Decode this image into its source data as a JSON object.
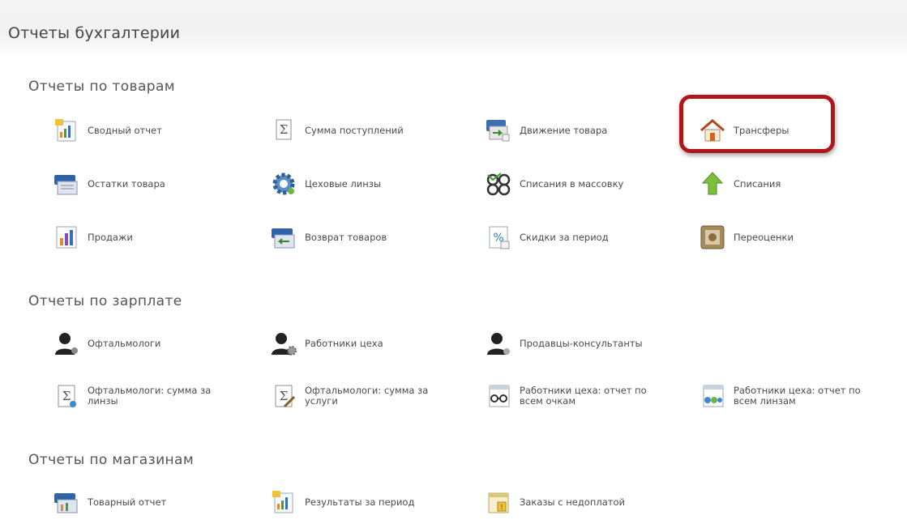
{
  "header": {
    "title": "Отчеты бухгалтерии"
  },
  "sections": [
    {
      "title": "Отчеты по товарам",
      "items": [
        {
          "label": "Сводный отчет",
          "icon": "summary-report-icon"
        },
        {
          "label": "Сумма поступлений",
          "icon": "sigma-document-icon"
        },
        {
          "label": "Движение товара",
          "icon": "goods-movement-icon"
        },
        {
          "label": "Трансферы",
          "icon": "house-icon"
        },
        {
          "label": "Остатки товара",
          "icon": "goods-stock-icon"
        },
        {
          "label": "Цеховые линзы",
          "icon": "gear-icon"
        },
        {
          "label": "Списания в массовку",
          "icon": "glasses-icon"
        },
        {
          "label": "Списания",
          "icon": "up-arrow-icon"
        },
        {
          "label": "Продажи",
          "icon": "sales-chart-icon"
        },
        {
          "label": "Возврат товаров",
          "icon": "goods-return-icon"
        },
        {
          "label": "Скидки за период",
          "icon": "discount-icon"
        },
        {
          "label": "Переоценки",
          "icon": "revaluation-icon"
        }
      ]
    },
    {
      "title": "Отчеты по зарплате",
      "items": [
        {
          "label": "Офтальмологи",
          "icon": "user-icon"
        },
        {
          "label": "Работники цеха",
          "icon": "user-gear-icon"
        },
        {
          "label": "Продавцы-консультанты",
          "icon": "user-icon"
        },
        {
          "label": "Офтальмологи: сумма за линзы",
          "icon": "sigma-document-icon"
        },
        {
          "label": "Офтальмологи: сумма за услуги",
          "icon": "sigma-tools-icon"
        },
        {
          "label": "Работники цеха: отчет по всем очкам",
          "icon": "glasses-calendar-icon"
        },
        {
          "label": "Работники цеха: отчет по всем линзам",
          "icon": "lenses-calendar-icon"
        }
      ]
    },
    {
      "title": "Отчеты по магазинам",
      "items": [
        {
          "label": "Товарный отчет",
          "icon": "goods-report-icon"
        },
        {
          "label": "Результаты за период",
          "icon": "period-results-icon"
        },
        {
          "label": "Заказы с недоплатой",
          "icon": "underpaid-orders-icon"
        }
      ]
    }
  ],
  "colors": {
    "highlight": "#b0161b",
    "header_bg": "#f3f3f3"
  }
}
